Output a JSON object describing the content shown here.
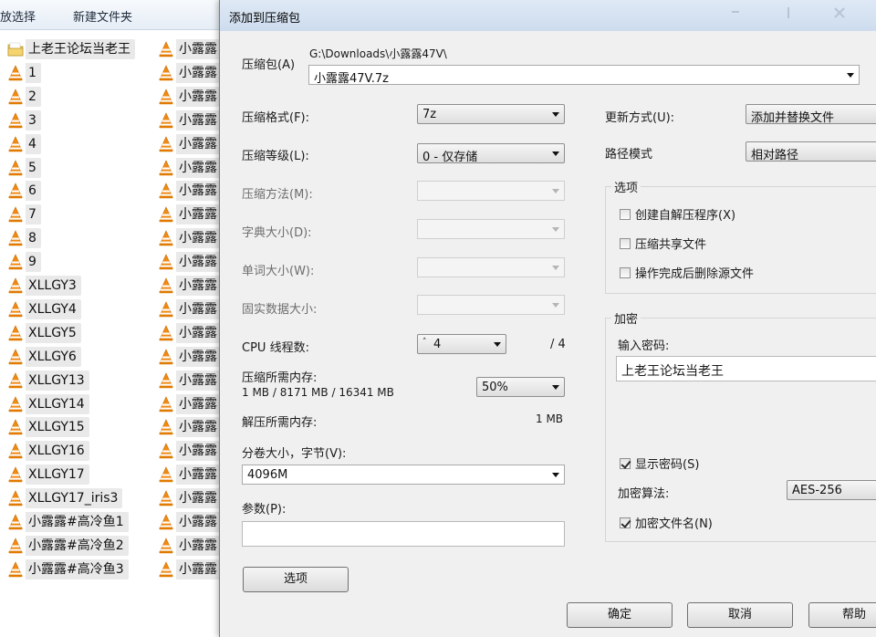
{
  "explorer": {
    "toolbar": {
      "select_label": "放选择",
      "new_folder_label": "新建文件夹"
    },
    "left_files": [
      "上老王论坛当老王",
      "1",
      "2",
      "3",
      "4",
      "5",
      "6",
      "7",
      "8",
      "9",
      "XLLGY3",
      "XLLGY4",
      "XLLGY5",
      "XLLGY6",
      "XLLGY13",
      "XLLGY14",
      "XLLGY15",
      "XLLGY16",
      "XLLGY17",
      "XLLGY17_iris3",
      "小露露#高冷鱼1",
      "小露露#高冷鱼2",
      "小露露#高冷鱼3"
    ],
    "right_files": [
      "小露露",
      "小露露",
      "小露露",
      "小露露",
      "小露露",
      "小露露",
      "小露露",
      "小露露",
      "小露露",
      "小露露",
      "小露露",
      "小露露",
      "小露露",
      "小露露",
      "小露露",
      "小露露",
      "小露露",
      "小露露",
      "小露露",
      "小露露",
      "小露露",
      "小露露",
      "小露露"
    ]
  },
  "dialog": {
    "title": "添加到压缩包",
    "archive_label": "压缩包(A)",
    "archive_path": "G:\\Downloads\\小露露47V\\",
    "archive_name": "小露露47V.7z",
    "format_label": "压缩格式(F):",
    "format_value": "7z",
    "level_label": "压缩等级(L):",
    "level_value": "0 - 仅存储",
    "method_label": "压缩方法(M):",
    "dict_label": "字典大小(D):",
    "word_label": "单词大小(W):",
    "solid_label": "固实数据大小:",
    "cpu_label": "CPU 线程数:",
    "cpu_value": "4",
    "cpu_max": "/ 4",
    "mem_comp_label": "压缩所需内存:",
    "mem_comp_value": "1 MB / 8171 MB / 16341 MB",
    "mem_percent": "50%",
    "mem_decomp_label": "解压所需内存:",
    "mem_decomp_value": "1 MB",
    "split_label": "分卷大小，字节(V):",
    "split_value": "4096M",
    "params_label": "参数(P):",
    "params_value": "",
    "options_button": "选项",
    "update_label": "更新方式(U):",
    "update_value": "添加并替换文件",
    "path_label": "路径模式",
    "path_value": "相对路径",
    "options_group": "选项",
    "opt_sfx": "创建自解压程序(X)",
    "opt_shared": "压缩共享文件",
    "opt_delete": "操作完成后删除源文件",
    "encrypt_group": "加密",
    "password_label": "输入密码:",
    "password_value": "上老王论坛当老王",
    "show_password": "显示密码(S)",
    "enc_method_label": "加密算法:",
    "enc_method_value": "AES-256",
    "encrypt_names": "加密文件名(N)",
    "ok_button": "确定",
    "cancel_button": "取消",
    "help_button": "帮助"
  },
  "colors": {
    "vlc_orange": "#f08a12",
    "titlebar": "#cddcee"
  }
}
